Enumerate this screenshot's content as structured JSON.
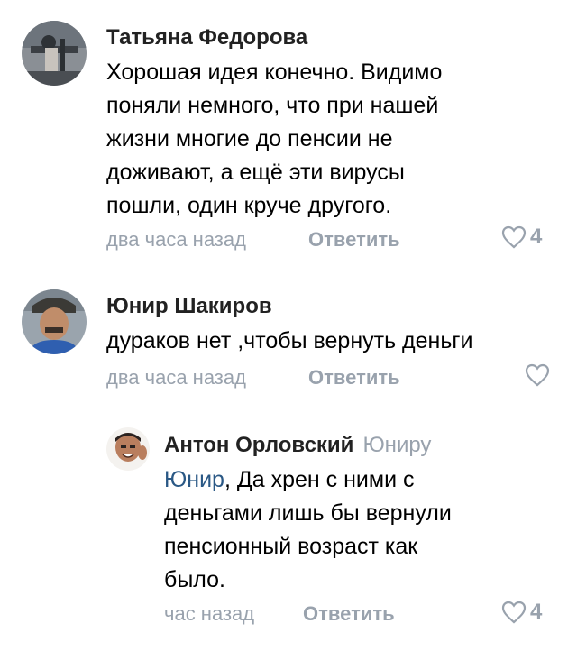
{
  "comments": [
    {
      "author": "Татьяна Федорова",
      "text_lines": [
        "Хорошая идея конечно. Видимо",
        "поняли немного, что при нашей",
        "жизни многие до пенсии не",
        "доживают, а ещё эти вирусы",
        "пошли, один круче другого."
      ],
      "time": "два часа назад",
      "reply_label": "Ответить",
      "likes": "4",
      "avatar_icon": "photo-avatar"
    },
    {
      "author": "Юнир Шакиров",
      "text_lines": [
        "дураков нет ,чтобы вернуть деньги"
      ],
      "time": "два часа назад",
      "reply_label": "Ответить",
      "likes": "",
      "avatar_icon": "photo-avatar"
    },
    {
      "author": "Антон Орловский",
      "reply_to": "Юниру",
      "mention": "Юнир",
      "text_first_rest": ", Да хрен с ними с",
      "text_lines": [
        "деньгами лишь бы вернули",
        "пенсионный возраст как",
        "было."
      ],
      "time": "час назад",
      "reply_label": "Ответить",
      "likes": "4",
      "avatar_icon": "photo-avatar"
    }
  ],
  "colors": {
    "meta": "#99a2ad",
    "mention": "#2a5885",
    "text": "#000000"
  },
  "icons": {
    "like": "heart-outline-icon"
  }
}
